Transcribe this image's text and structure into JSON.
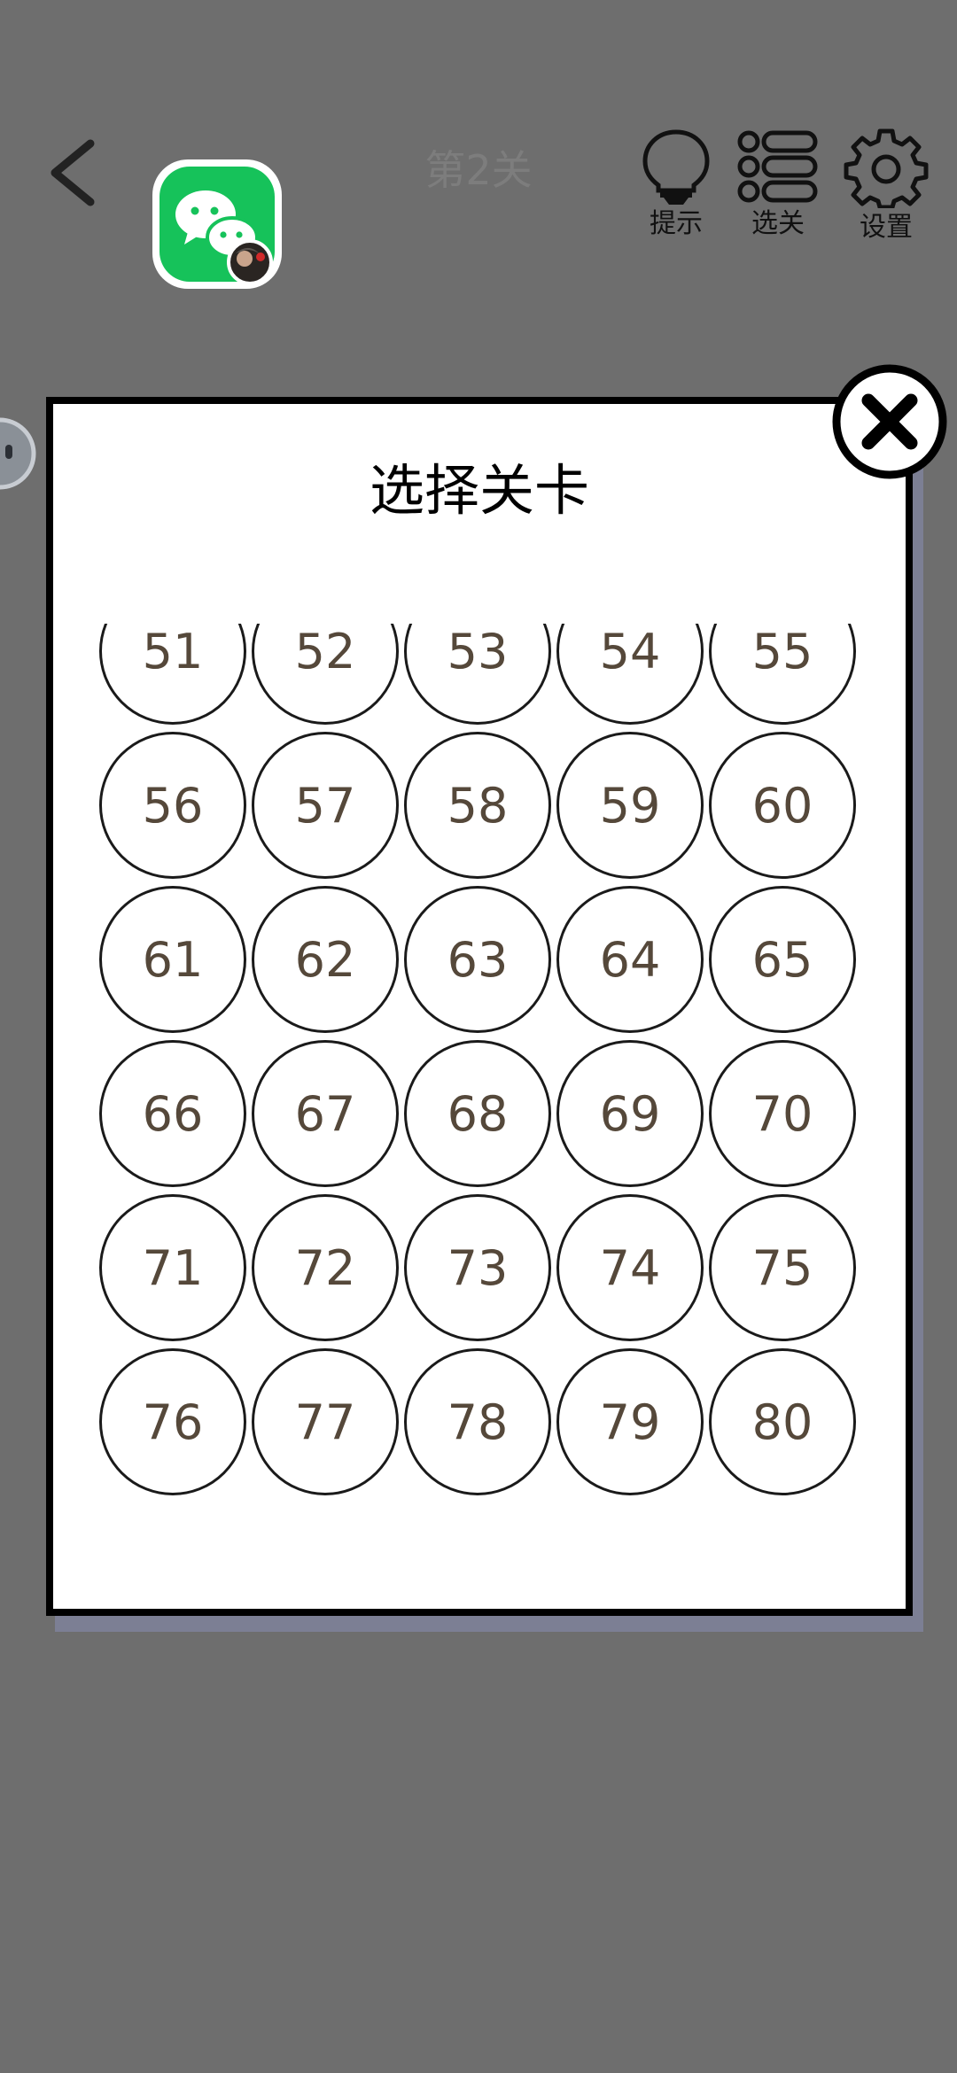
{
  "header": {
    "level_title": "第2关",
    "tools": [
      {
        "label": "提示",
        "icon": "lightbulb-icon"
      },
      {
        "label": "选关",
        "icon": "level-list-icon"
      },
      {
        "label": "设置",
        "icon": "gear-icon"
      }
    ]
  },
  "app_icon": "wechat-icon",
  "modal": {
    "title": "选择关卡",
    "levels": [
      "51",
      "52",
      "53",
      "54",
      "55",
      "56",
      "57",
      "58",
      "59",
      "60",
      "61",
      "62",
      "63",
      "64",
      "65",
      "66",
      "67",
      "68",
      "69",
      "70",
      "71",
      "72",
      "73",
      "74",
      "75",
      "76",
      "77",
      "78",
      "79",
      "80"
    ]
  },
  "colors": {
    "background": "#6e6e6e",
    "level_number": "#55483a",
    "wechat_green": "#16c25a"
  }
}
